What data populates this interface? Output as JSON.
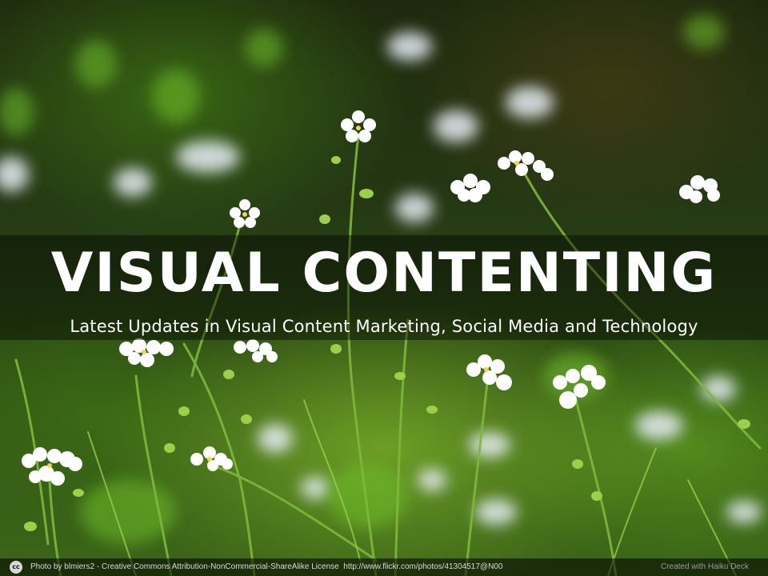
{
  "slide": {
    "title": "VISUAL CONTENTING",
    "subtitle": "Latest Updates in Visual Content Marketing, Social Media and Technology"
  },
  "footer": {
    "cc_icon": "cc",
    "photo_credit": "Photo by blmiers2 - Creative Commons Attribution-NonCommercial-ShareAlike License",
    "photo_url": "http://www.flickr.com/photos/41304517@N00",
    "created_with": "Created with Haiku Deck"
  },
  "colors": {
    "title_text": "#ffffff",
    "band": "#000000",
    "foliage": "#3c6618"
  },
  "icons": {
    "license": "creative-commons-icon"
  }
}
